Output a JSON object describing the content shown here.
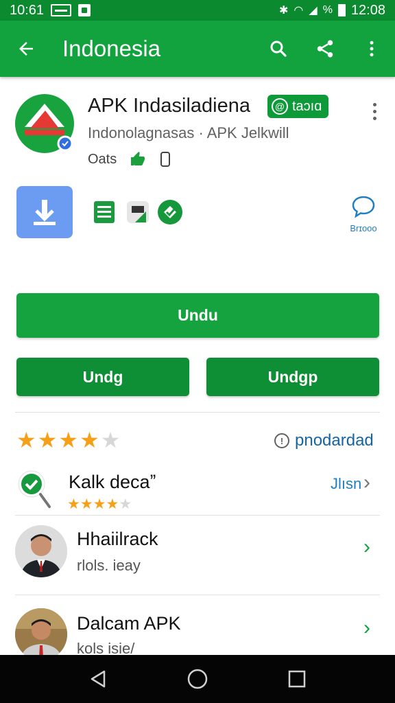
{
  "status_bar": {
    "time_left": "10:61",
    "time_right": "12:08",
    "battery_label": "%"
  },
  "app_bar": {
    "title": "Indonesia"
  },
  "app": {
    "name": "APK Indasiladiena",
    "badge": "taɔıɑ",
    "developer": "Indonolagnasas · APK Jelkwill",
    "meta_text": "Oats"
  },
  "chat": {
    "label": "Brɪooo"
  },
  "buttons": {
    "download": "Undu",
    "left": "Undg",
    "right": "Undgp"
  },
  "rating": {
    "stars": 4,
    "max": 5,
    "popular_label": "pnodardad"
  },
  "list": [
    {
      "title": "Kalk decaˮ",
      "link": "Jlısn",
      "stars": 4
    },
    {
      "title": "Hhaiilrack",
      "subtitle": "rlols. ieay"
    },
    {
      "title": "Dalcam APK",
      "subtitle": "kols isie/"
    }
  ],
  "colors": {
    "app_bar": "#12a23e",
    "status_bar": "#0b8a2f",
    "button": "#15a33f",
    "star": "#f6a01a",
    "link": "#1565a6"
  }
}
